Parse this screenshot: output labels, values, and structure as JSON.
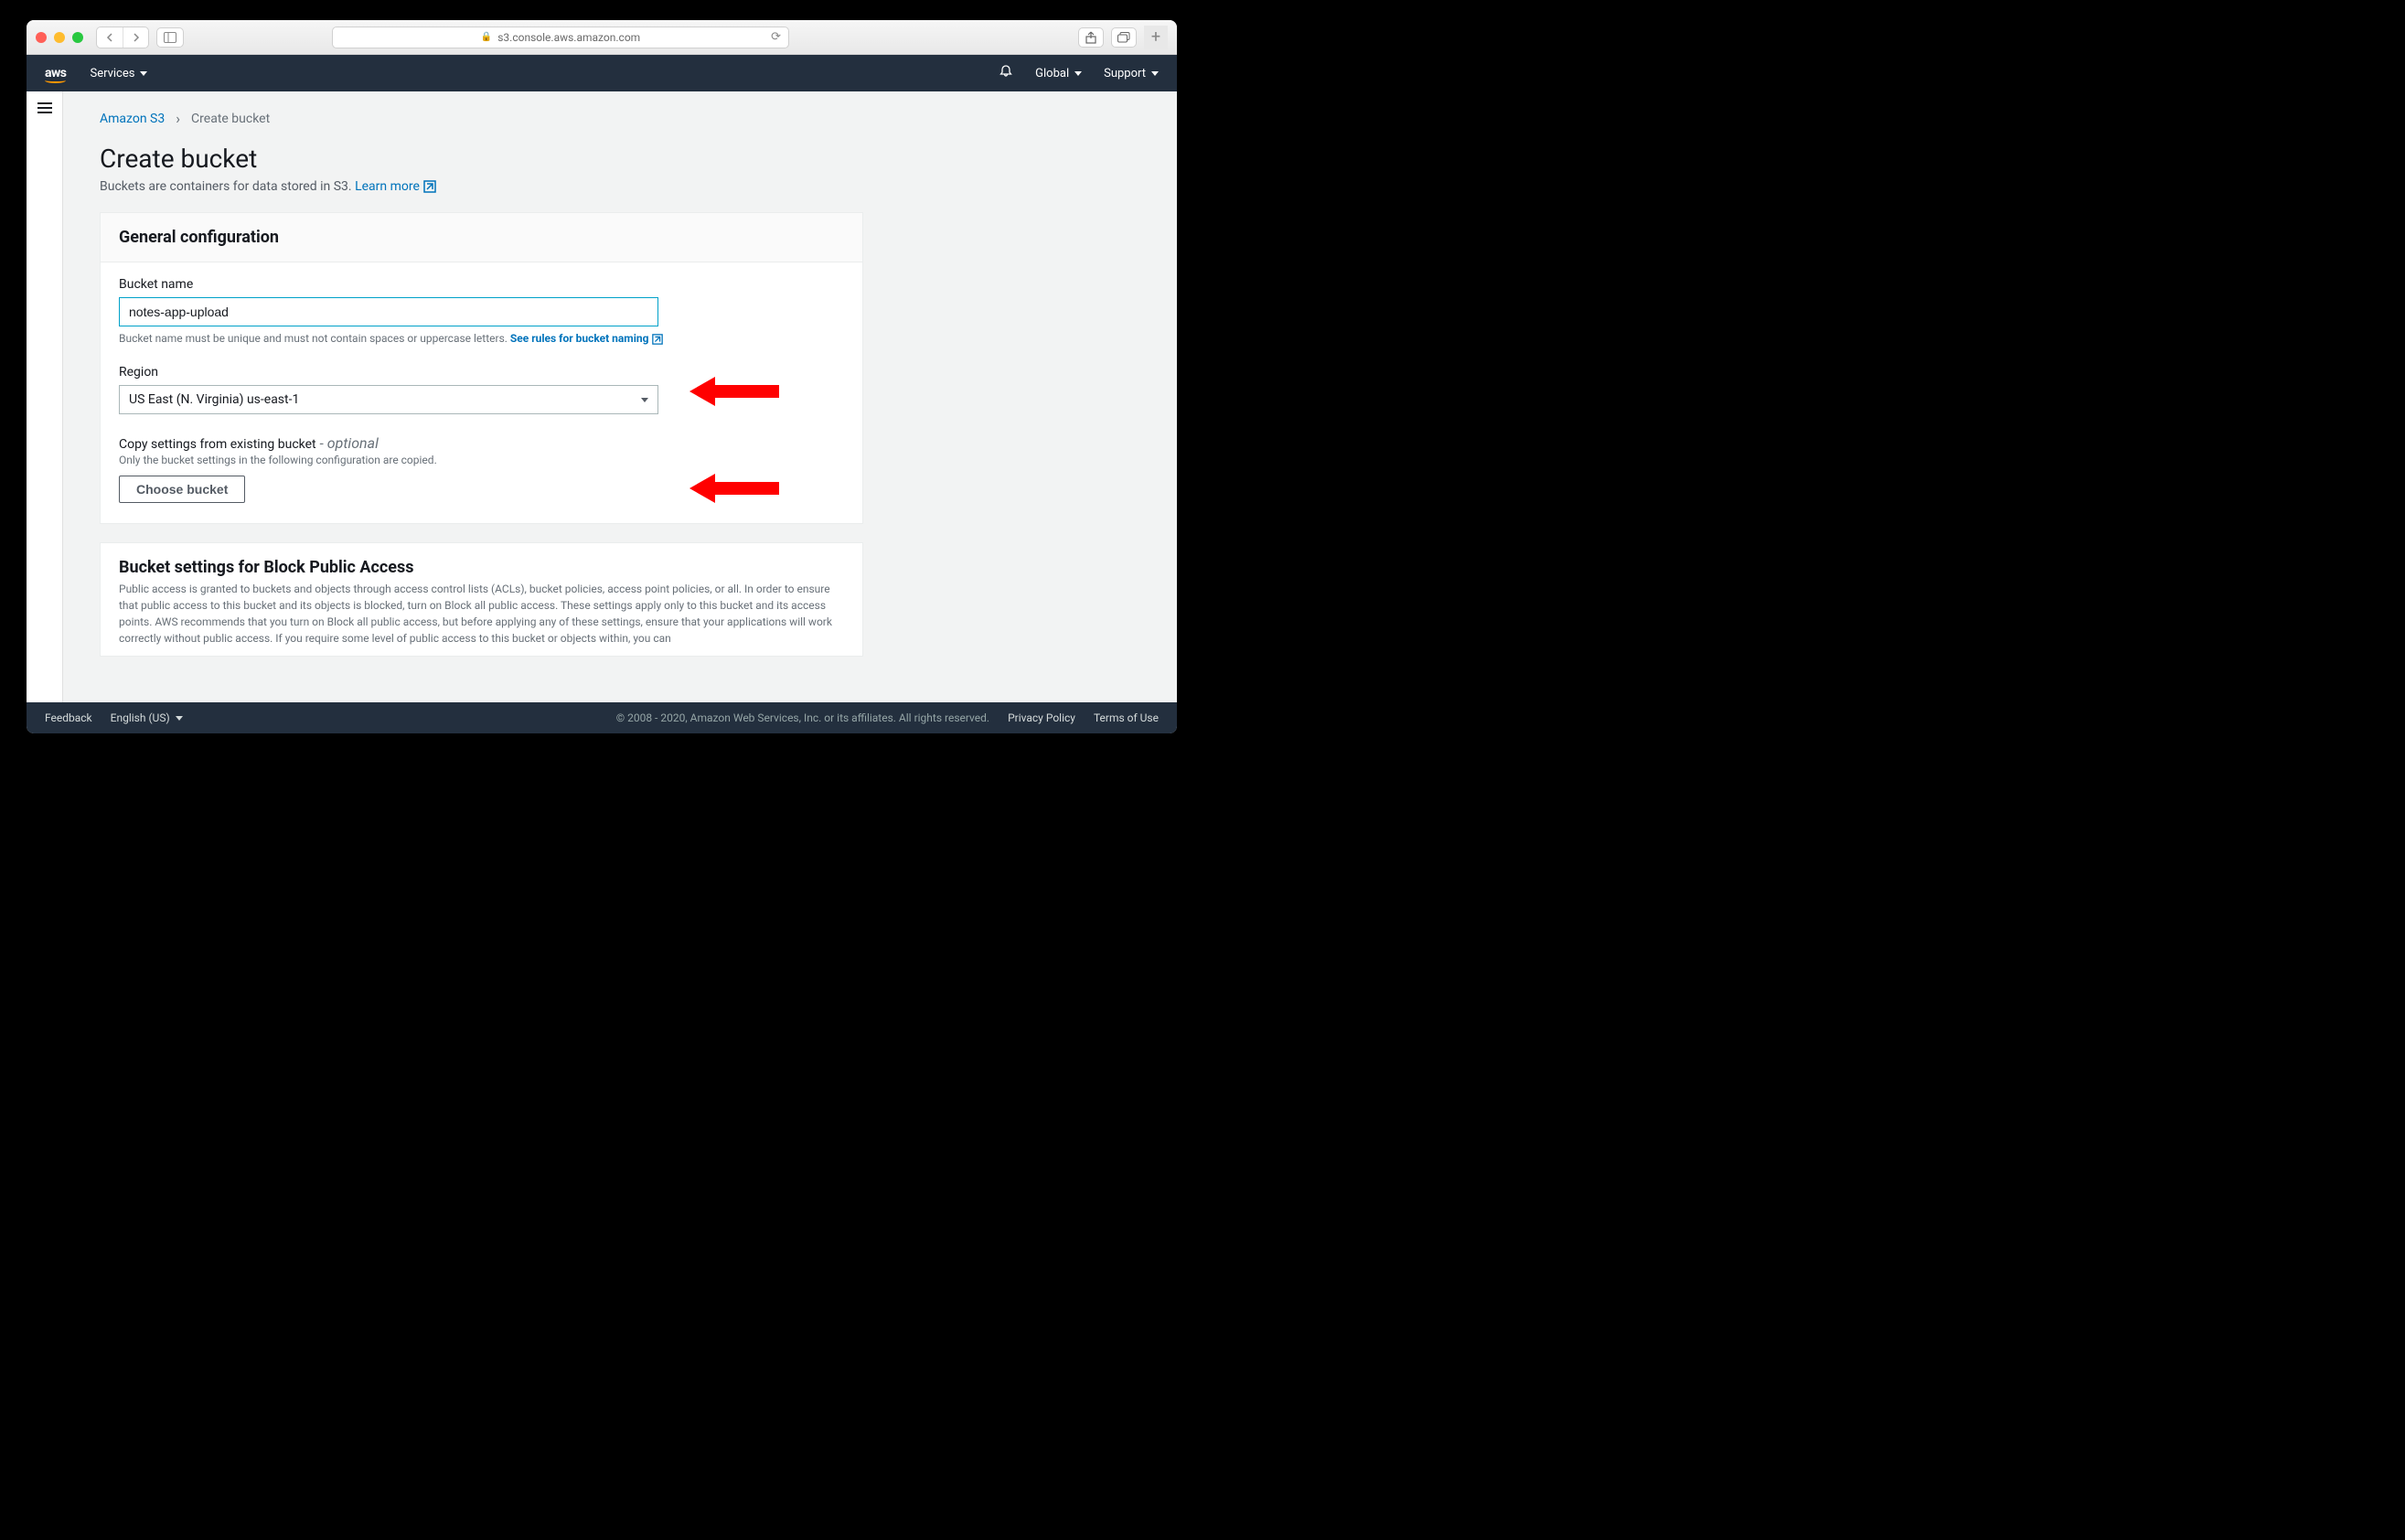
{
  "browser": {
    "url": "s3.console.aws.amazon.com"
  },
  "header": {
    "logo": "aws",
    "services": "Services",
    "global": "Global",
    "support": "Support"
  },
  "breadcrumb": {
    "root": "Amazon S3",
    "current": "Create bucket"
  },
  "page": {
    "title": "Create bucket",
    "desc": "Buckets are containers for data stored in S3. ",
    "learnMore": "Learn more"
  },
  "general": {
    "heading": "General configuration",
    "bucketNameLabel": "Bucket name",
    "bucketNameValue": "notes-app-upload",
    "bucketNameHint": "Bucket name must be unique and must not contain spaces or uppercase letters. ",
    "bucketNameRules": "See rules for bucket naming",
    "regionLabel": "Region",
    "regionValue": "US East (N. Virginia) us-east-1",
    "copyLabel": "Copy settings from existing bucket",
    "copyOptional": " - optional",
    "copyHint": "Only the bucket settings in the following configuration are copied.",
    "chooseBucket": "Choose bucket"
  },
  "block": {
    "heading": "Bucket settings for Block Public Access",
    "desc": "Public access is granted to buckets and objects through access control lists (ACLs), bucket policies, access point policies, or all. In order to ensure that public access to this bucket and its objects is blocked, turn on Block all public access. These settings apply only to this bucket and its access points. AWS recommends that you turn on Block all public access, but before applying any of these settings, ensure that your applications will work correctly without public access. If you require some level of public access to this bucket or objects within, you can"
  },
  "footer": {
    "feedback": "Feedback",
    "language": "English (US)",
    "copyright": "© 2008 - 2020, Amazon Web Services, Inc. or its affiliates. All rights reserved.",
    "privacy": "Privacy Policy",
    "terms": "Terms of Use"
  }
}
